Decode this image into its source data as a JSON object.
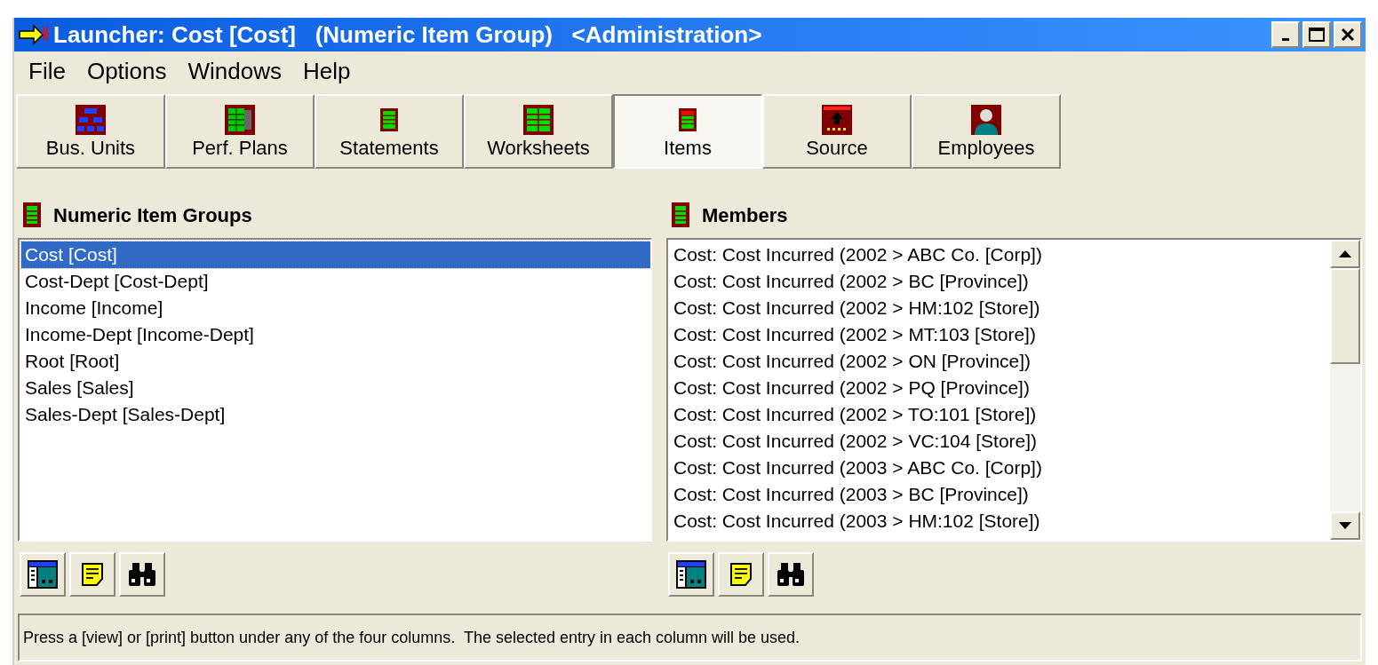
{
  "window": {
    "title": "Launcher: Cost [Cost]   (Numeric Item Group)   <Administration>"
  },
  "menu": [
    "File",
    "Options",
    "Windows",
    "Help"
  ],
  "tabs": [
    {
      "label": "Bus. Units",
      "kind": "units",
      "selected": false
    },
    {
      "label": "Perf. Plans",
      "kind": "plans",
      "selected": false
    },
    {
      "label": "Statements",
      "kind": "statements",
      "selected": false
    },
    {
      "label": "Worksheets",
      "kind": "worksheets",
      "selected": false
    },
    {
      "label": "Items",
      "kind": "items",
      "selected": true
    },
    {
      "label": "Source",
      "kind": "source",
      "selected": false
    },
    {
      "label": "Employees",
      "kind": "employees",
      "selected": false
    }
  ],
  "groups": {
    "title": "Numeric Item Groups",
    "items": [
      {
        "label": "Cost [Cost]",
        "selected": true
      },
      {
        "label": "Cost-Dept [Cost-Dept]",
        "selected": false
      },
      {
        "label": "Income [Income]",
        "selected": false
      },
      {
        "label": "Income-Dept [Income-Dept]",
        "selected": false
      },
      {
        "label": "Root [Root]",
        "selected": false
      },
      {
        "label": "Sales [Sales]",
        "selected": false
      },
      {
        "label": "Sales-Dept [Sales-Dept]",
        "selected": false
      }
    ]
  },
  "members": {
    "title": "Members",
    "items": [
      {
        "label": "Cost: Cost Incurred (2002 > ABC Co. [Corp])",
        "selected": false
      },
      {
        "label": "Cost: Cost Incurred (2002 > BC [Province])",
        "selected": false
      },
      {
        "label": "Cost: Cost Incurred (2002 > HM:102 [Store])",
        "selected": false
      },
      {
        "label": "Cost: Cost Incurred (2002 > MT:103 [Store])",
        "selected": false
      },
      {
        "label": "Cost: Cost Incurred (2002 > ON [Province])",
        "selected": false
      },
      {
        "label": "Cost: Cost Incurred (2002 > PQ [Province])",
        "selected": false
      },
      {
        "label": "Cost: Cost Incurred (2002 > TO:101 [Store])",
        "selected": false
      },
      {
        "label": "Cost: Cost Incurred (2002 > VC:104 [Store])",
        "selected": false
      },
      {
        "label": "Cost: Cost Incurred (2003 > ABC Co. [Corp])",
        "selected": false
      },
      {
        "label": "Cost: Cost Incurred (2003 > BC [Province])",
        "selected": false
      },
      {
        "label": "Cost: Cost Incurred (2003 > HM:102 [Store])",
        "selected": false
      }
    ]
  },
  "status_bar": "Press a [view] or [print] button under any of the four columns.  The selected entry in each column will be used."
}
